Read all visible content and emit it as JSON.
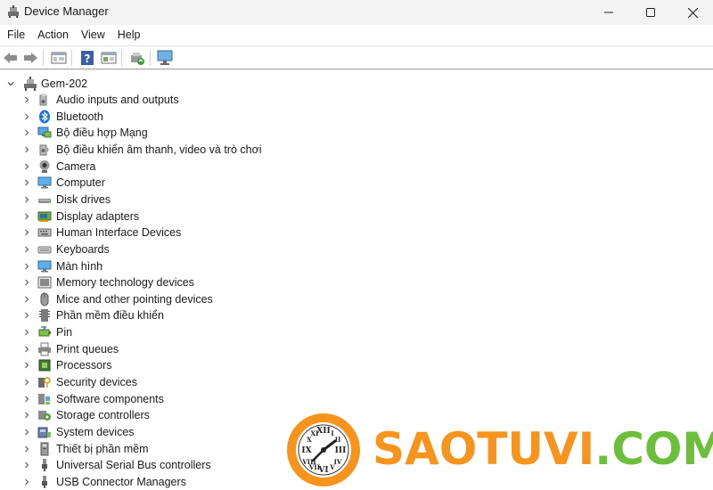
{
  "window": {
    "title": "Device Manager"
  },
  "menu": [
    "File",
    "Action",
    "View",
    "Help"
  ],
  "toolbar": {
    "buttons": [
      "back-arrow-icon",
      "forward-arrow-icon",
      "properties-icon",
      "help-icon",
      "show-hidden-icon",
      "update-driver-icon",
      "scan-hardware-icon"
    ]
  },
  "tree": {
    "root": "Gem-202",
    "items": [
      {
        "label": "Audio inputs and outputs",
        "icon": "speaker-icon"
      },
      {
        "label": "Bluetooth",
        "icon": "bluetooth-icon"
      },
      {
        "label": "Bộ điều hợp Mạng",
        "icon": "network-adapter-icon"
      },
      {
        "label": "Bộ điều khiển âm thanh, video và trò chơi",
        "icon": "sound-controller-icon"
      },
      {
        "label": "Camera",
        "icon": "camera-icon"
      },
      {
        "label": "Computer",
        "icon": "computer-icon"
      },
      {
        "label": "Disk drives",
        "icon": "disk-drive-icon"
      },
      {
        "label": "Display adapters",
        "icon": "display-adapter-icon"
      },
      {
        "label": "Human Interface Devices",
        "icon": "hid-icon"
      },
      {
        "label": "Keyboards",
        "icon": "keyboard-icon"
      },
      {
        "label": "Màn hình",
        "icon": "monitor-icon"
      },
      {
        "label": "Memory technology devices",
        "icon": "memory-device-icon"
      },
      {
        "label": "Mice and other pointing devices",
        "icon": "mouse-icon"
      },
      {
        "label": "Phần mềm điều khiển",
        "icon": "firmware-icon"
      },
      {
        "label": "Pin",
        "icon": "battery-icon"
      },
      {
        "label": "Print queues",
        "icon": "printer-icon"
      },
      {
        "label": "Processors",
        "icon": "processor-icon"
      },
      {
        "label": "Security devices",
        "icon": "security-device-icon"
      },
      {
        "label": "Software components",
        "icon": "software-component-icon"
      },
      {
        "label": "Storage controllers",
        "icon": "storage-controller-icon"
      },
      {
        "label": "System devices",
        "icon": "system-device-icon"
      },
      {
        "label": "Thiết bị phần mềm",
        "icon": "software-device-icon"
      },
      {
        "label": "Universal Serial Bus controllers",
        "icon": "usb-controller-icon"
      },
      {
        "label": "USB Connector Managers",
        "icon": "usb-connector-icon"
      }
    ]
  },
  "watermark": {
    "text_orange": "SAOTUVI",
    "text_green": ".COM",
    "color_orange": "#f7941d",
    "color_green": "#6cbf3a"
  }
}
